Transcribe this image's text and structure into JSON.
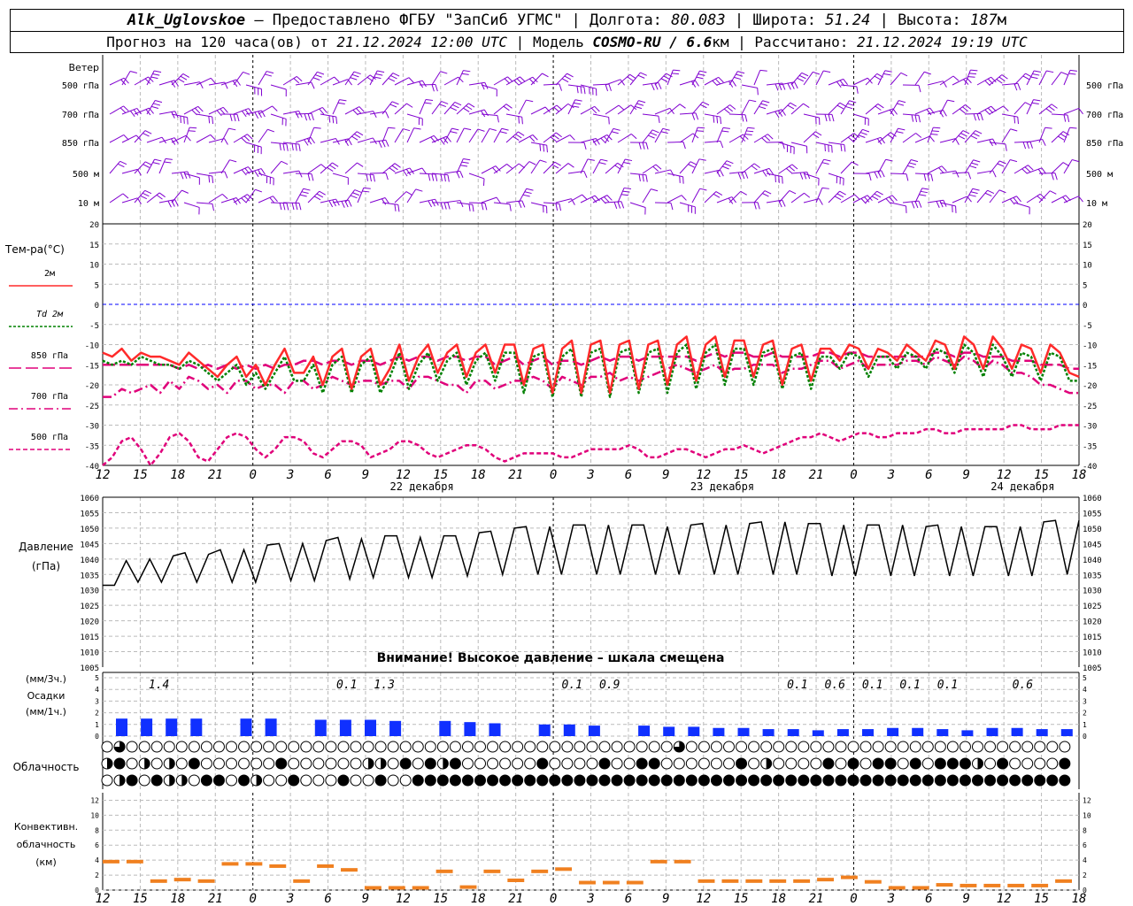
{
  "header": {
    "station": "Alk_Uglovskoe",
    "provider": "– Предоставлено ФГБУ \"ЗапСиб УГМС\"",
    "lon_label": "Долгота:",
    "lon": "80.083",
    "lat_label": "Широта:",
    "lat": "51.24",
    "alt_label": "Высота:",
    "alt": "187",
    "alt_unit": "м",
    "forecast_label": "Прогноз на 120 часа(ов)  от",
    "forecast_start": "21.12.2024 12:00 UTC",
    "model_label": "Модель",
    "model": "COSMO-RU / 6.6",
    "model_unit": "км",
    "calc_label": "Рассчитано:",
    "calc_time": "21.12.2024 19:19 UTC"
  },
  "colors": {
    "t2m": "#ff2a2a",
    "td2m": "#008000",
    "t850": "#e0007a",
    "t700": "#e0007a",
    "t500": "#e0007a",
    "wind": "#8000d0",
    "precip": "#1030ff",
    "conv": "#f08020",
    "zero": "#0000ff"
  },
  "wind_panel": {
    "title": "Ветер",
    "levels": [
      "500 гПа",
      "700 гПа",
      "850 гПа",
      "500 м",
      "10  м"
    ],
    "speeds_note": "barbs show direction and speed, per level, per 3 h step"
  },
  "temp_panel": {
    "title": "Тем-ра(°C)",
    "legend": [
      {
        "label": "2м",
        "style": "solid"
      },
      {
        "label": "Td  2м",
        "style": "dotted"
      },
      {
        "label": "850 гПа",
        "style": "long-dash"
      },
      {
        "label": "700 гПа",
        "style": "dash-dot"
      },
      {
        "label": "500 гПа",
        "style": "short-dash"
      }
    ],
    "y_ticks": [
      "20",
      "15",
      "10",
      "5",
      "0",
      "-5",
      "-10",
      "-15",
      "-20",
      "-25",
      "-30",
      "-35",
      "-40"
    ]
  },
  "time_axis": {
    "hours": [
      "12",
      "15",
      "18",
      "21",
      "0",
      "3",
      "6",
      "9",
      "12",
      "15",
      "18",
      "21",
      "0",
      "3",
      "6",
      "9",
      "12",
      "15",
      "18",
      "21",
      "0",
      "3",
      "6",
      "9",
      "12",
      "15",
      "18"
    ],
    "dates": [
      "22 декабря",
      "23 декабря",
      "24 декабря"
    ]
  },
  "pressure_panel": {
    "title1": "Давление",
    "title2": "(гПа)",
    "warning": "Внимание! Высокое давление – шкала смещена",
    "y_ticks": [
      "1060",
      "1055",
      "1050",
      "1045",
      "1040",
      "1035",
      "1030",
      "1025",
      "1020",
      "1015",
      "1010",
      "1005"
    ]
  },
  "precip_panel": {
    "title1": "(мм/3ч.)",
    "title2": "Осадки",
    "title3": "(мм/1ч.)",
    "y_ticks": [
      "5",
      "4",
      "3",
      "2",
      "1",
      "0"
    ],
    "totals": [
      {
        "h": 1.5,
        "text": "1.4"
      },
      {
        "h": 6.5,
        "text": "0.1"
      },
      {
        "h": 7.5,
        "text": "1.3"
      },
      {
        "h": 12.5,
        "text": "0.1"
      },
      {
        "h": 13.5,
        "text": "0.9"
      },
      {
        "h": 18.5,
        "text": "0.1"
      },
      {
        "h": 19.5,
        "text": "0.6"
      },
      {
        "h": 20.5,
        "text": "0.1"
      },
      {
        "h": 21.5,
        "text": "0.1"
      },
      {
        "h": 22.5,
        "text": "0.1"
      },
      {
        "h": 24.5,
        "text": "0.6"
      }
    ]
  },
  "cloud_panel": {
    "title": "Облачность"
  },
  "conv_panel": {
    "title1": "Конвективн.",
    "title2": "облачность",
    "title3": "(км)",
    "y_ticks": [
      "12",
      "10",
      "8",
      "6",
      "4",
      "2",
      "0"
    ]
  },
  "chart_data": [
    {
      "type": "line",
      "title": "Тем-ра(°C)",
      "x_unit": "hours from 21.12.2024 12:00 UTC, 1 h step",
      "x_start": 0,
      "x_end": 102,
      "ylim": [
        -40,
        20
      ],
      "series": [
        {
          "name": "2м",
          "values": [
            -12,
            -13,
            -11,
            -14,
            -12,
            -13,
            -13,
            -14,
            -15,
            -12,
            -14,
            -16,
            -18,
            -15,
            -13,
            -18,
            -15,
            -20,
            -15,
            -11,
            -17,
            -17,
            -13,
            -20,
            -13,
            -11,
            -21,
            -13,
            -11,
            -20,
            -16,
            -10,
            -19,
            -13,
            -10,
            -17,
            -12,
            -10,
            -18,
            -12,
            -10,
            -17,
            -10,
            -10,
            -20,
            -11,
            -10,
            -22,
            -11,
            -9,
            -22,
            -10,
            -9,
            -22,
            -10,
            -9,
            -21,
            -10,
            -9,
            -20,
            -10,
            -8,
            -19,
            -10,
            -8,
            -18,
            -9,
            -9,
            -18,
            -10,
            -9,
            -20,
            -11,
            -10,
            -19,
            -11,
            -11,
            -14,
            -10,
            -11,
            -16,
            -11,
            -12,
            -14,
            -10,
            -12,
            -14,
            -9,
            -10,
            -16,
            -8,
            -10,
            -16,
            -8,
            -11,
            -16,
            -10,
            -11,
            -17,
            -10,
            -12,
            -17,
            -18
          ]
        },
        {
          "name": "Td  2м",
          "values": [
            -14,
            -15,
            -14,
            -15,
            -13,
            -14,
            -15,
            -15,
            -16,
            -14,
            -15,
            -17,
            -19,
            -17,
            -15,
            -20,
            -17,
            -21,
            -17,
            -13,
            -19,
            -19,
            -15,
            -22,
            -15,
            -13,
            -22,
            -15,
            -13,
            -22,
            -18,
            -12,
            -21,
            -15,
            -12,
            -19,
            -14,
            -12,
            -20,
            -14,
            -12,
            -19,
            -12,
            -12,
            -22,
            -13,
            -12,
            -23,
            -13,
            -11,
            -23,
            -12,
            -11,
            -23,
            -12,
            -11,
            -22,
            -12,
            -11,
            -22,
            -12,
            -10,
            -21,
            -12,
            -10,
            -20,
            -11,
            -11,
            -20,
            -12,
            -11,
            -21,
            -13,
            -12,
            -21,
            -13,
            -13,
            -16,
            -12,
            -13,
            -18,
            -13,
            -13,
            -16,
            -12,
            -13,
            -16,
            -11,
            -12,
            -17,
            -10,
            -12,
            -18,
            -10,
            -13,
            -18,
            -12,
            -13,
            -19,
            -12,
            -13,
            -19,
            -19
          ]
        },
        {
          "name": "850 гПа",
          "values": [
            -15,
            -15,
            -15,
            -15,
            -15,
            -15,
            -15,
            -15,
            -16,
            -15,
            -16,
            -15,
            -16,
            -15,
            -16,
            -15,
            -16,
            -15,
            -16,
            -15,
            -15,
            -14,
            -14,
            -15,
            -14,
            -14,
            -15,
            -14,
            -14,
            -15,
            -14,
            -13,
            -14,
            -13,
            -13,
            -14,
            -13,
            -13,
            -14,
            -13,
            -13,
            -15,
            -14,
            -13,
            -15,
            -14,
            -13,
            -15,
            -14,
            -14,
            -15,
            -14,
            -13,
            -14,
            -13,
            -13,
            -14,
            -13,
            -13,
            -13,
            -13,
            -13,
            -14,
            -13,
            -12,
            -13,
            -12,
            -12,
            -13,
            -13,
            -12,
            -13,
            -13,
            -13,
            -13,
            -12,
            -12,
            -13,
            -12,
            -12,
            -13,
            -13,
            -13,
            -13,
            -13,
            -13,
            -13,
            -12,
            -12,
            -13,
            -12,
            -12,
            -13,
            -13,
            -13,
            -14,
            -14,
            -14,
            -15,
            -15,
            -15,
            -16,
            -16
          ]
        },
        {
          "name": "700 гПа",
          "values": [
            -23,
            -23,
            -21,
            -22,
            -21,
            -20,
            -22,
            -19,
            -21,
            -18,
            -19,
            -21,
            -20,
            -22,
            -19,
            -19,
            -21,
            -20,
            -20,
            -22,
            -19,
            -19,
            -21,
            -20,
            -18,
            -19,
            -20,
            -19,
            -19,
            -20,
            -19,
            -19,
            -21,
            -18,
            -18,
            -19,
            -20,
            -20,
            -22,
            -19,
            -19,
            -21,
            -20,
            -19,
            -19,
            -18,
            -19,
            -21,
            -18,
            -19,
            -20,
            -18,
            -18,
            -17,
            -19,
            -18,
            -19,
            -18,
            -17,
            -16,
            -15,
            -16,
            -17,
            -16,
            -15,
            -17,
            -16,
            -16,
            -15,
            -15,
            -15,
            -17,
            -16,
            -16,
            -15,
            -14,
            -14,
            -16,
            -15,
            -14,
            -16,
            -15,
            -15,
            -15,
            -14,
            -14,
            -15,
            -13,
            -14,
            -15,
            -13,
            -14,
            -16,
            -14,
            -15,
            -17,
            -17,
            -18,
            -20,
            -20,
            -21,
            -22,
            -22
          ]
        },
        {
          "name": "500 гПа",
          "values": [
            -40,
            -38,
            -34,
            -33,
            -36,
            -40,
            -37,
            -33,
            -32,
            -34,
            -38,
            -39,
            -36,
            -33,
            -32,
            -33,
            -36,
            -38,
            -36,
            -33,
            -33,
            -34,
            -37,
            -38,
            -36,
            -34,
            -34,
            -35,
            -38,
            -37,
            -36,
            -34,
            -34,
            -35,
            -37,
            -38,
            -37,
            -36,
            -35,
            -35,
            -36,
            -38,
            -39,
            -38,
            -37,
            -37,
            -37,
            -37,
            -38,
            -38,
            -37,
            -36,
            -36,
            -36,
            -36,
            -35,
            -36,
            -38,
            -38,
            -37,
            -36,
            -36,
            -37,
            -38,
            -37,
            -36,
            -36,
            -35,
            -36,
            -37,
            -36,
            -35,
            -34,
            -33,
            -33,
            -32,
            -33,
            -34,
            -33,
            -32,
            -32,
            -33,
            -33,
            -32,
            -32,
            -32,
            -31,
            -31,
            -32,
            -32,
            -31,
            -31,
            -31,
            -31,
            -31,
            -30,
            -30,
            -31,
            -31,
            -31,
            -30,
            -30,
            -30
          ]
        }
      ]
    },
    {
      "type": "line",
      "title": "Давление",
      "x_unit": "hours from 21.12.2024 12:00 UTC, 3 h step",
      "ylim": [
        1005,
        1060
      ],
      "series": [
        {
          "name": "Давление",
          "values": [
            1031.5,
            1031.5,
            1039.5,
            1032.5,
            1040,
            1032.5,
            1041,
            1042,
            1032.5,
            1041.5,
            1043,
            1032.5,
            1043,
            1032.5,
            1044.5,
            1045,
            1033,
            1045,
            1033,
            1046,
            1047,
            1033.5,
            1046.5,
            1034,
            1047.5,
            1047.5,
            1034,
            1047,
            1034,
            1047.5,
            1047.5,
            1034.5,
            1048.5,
            1049,
            1035,
            1050,
            1050.5,
            1035,
            1050.5,
            1035,
            1051,
            1051,
            1035,
            1051,
            1035,
            1051,
            1051,
            1035,
            1050.5,
            1035,
            1051,
            1051.5,
            1035,
            1051,
            1035,
            1051.5,
            1052,
            1035,
            1052,
            1035,
            1051.5,
            1051.5,
            1034.5,
            1051,
            1034.5,
            1051,
            1051,
            1034.5,
            1051,
            1034.5,
            1050.5,
            1051,
            1034.5,
            1050.5,
            1034.5,
            1050.5,
            1050.5,
            1034.5,
            1050.5,
            1034.5,
            1052,
            1052.5,
            1035,
            1052.5
          ]
        }
      ]
    },
    {
      "type": "bar",
      "title": "Осадки",
      "x_unit": "3 h intervals starting 21.12.2024 12:00 UTC",
      "categories": [
        "12",
        "15",
        "18",
        "21",
        "0",
        "3",
        "6",
        "9",
        "12",
        "15",
        "18",
        "21",
        "0",
        "3",
        "6",
        "9",
        "12",
        "15",
        "18",
        "21",
        "0",
        "3",
        "6",
        "9",
        "12",
        "15",
        "18"
      ],
      "series": [
        {
          "name": "(мм/1ч.)",
          "values": [
            1.5,
            1.5,
            1.5,
            1.5,
            0,
            1.5,
            1.5,
            0,
            1.4,
            1.4,
            1.4,
            1.3,
            0,
            1.3,
            1.2,
            1.1,
            0,
            1.0,
            1.0,
            0.9,
            0,
            0.9,
            0.8,
            0.8,
            0.7,
            0.7,
            0.6,
            0.6,
            0.5,
            0.6,
            0.6,
            0.7,
            0.7,
            0.6,
            0.5,
            0.7,
            0.7,
            0.6,
            0.6
          ]
        }
      ]
    },
    {
      "type": "table",
      "title": "Облачность",
      "rows": [
        "upper",
        "middle",
        "lower"
      ],
      "legend": [
        "clear",
        "quarter",
        "half",
        "three-quarter",
        "overcast"
      ]
    },
    {
      "type": "bar",
      "title": "Конвективн. облачность (км)",
      "ylim": [
        0,
        13
      ],
      "series": [
        {
          "name": "облачность",
          "values": [
            3.8,
            3.8,
            1.2,
            1.4,
            1.2,
            3.5,
            3.5,
            3.2,
            1.2,
            3.2,
            2.7,
            0.3,
            0.3,
            0.3,
            2.5,
            0.4,
            2.5,
            1.3,
            2.5,
            2.8,
            1.0,
            1.0,
            1.0,
            3.8,
            3.8,
            1.2,
            1.2,
            1.2,
            1.2,
            1.2,
            1.4,
            1.7,
            1.1,
            0.3,
            0.3,
            0.7,
            0.6,
            0.6,
            0.6,
            0.6,
            1.2
          ]
        }
      ]
    }
  ]
}
